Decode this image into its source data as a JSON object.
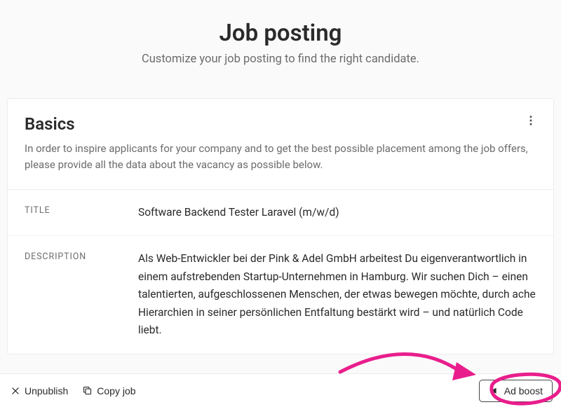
{
  "hero": {
    "title": "Job posting",
    "subtitle": "Customize your job posting to find the right candidate."
  },
  "card": {
    "section_title": "Basics",
    "section_desc": "In order to inspire applicants for your company and to get the best possible placement among the job offers, please provide all the data about the vacancy as possible below.",
    "fields": {
      "title_label": "TITLE",
      "title_value": "Software Backend Tester Laravel (m/w/d)",
      "description_label": "DESCRIPTION",
      "description_value": "Als Web-Entwickler bei der Pink & Adel GmbH arbeitest Du eigenverantwortlich in einem aufstrebenden Startup-Unternehmen in Hamburg. Wir suchen Dich – einen talentierten, aufgeschlossenen Menschen, der etwas bewegen möchte, durch ache Hierarchien in seiner persönlichen Entfaltung bestärkt wird – und natürlich Code liebt."
    }
  },
  "bottom_bar": {
    "unpublish_label": "Unpublish",
    "copy_label": "Copy job",
    "boost_label": "Ad boost"
  },
  "annotation": {
    "color": "#e91e8c"
  }
}
